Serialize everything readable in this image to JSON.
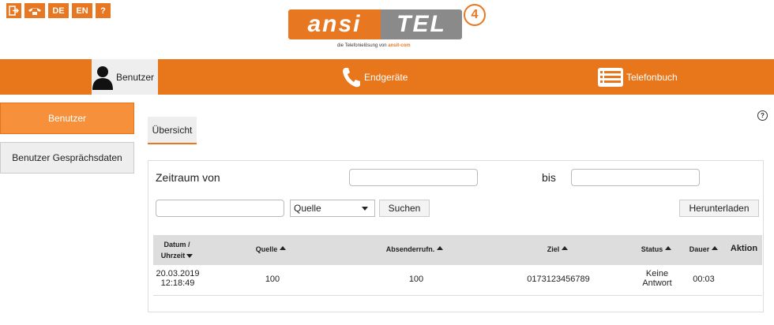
{
  "top_icons": {
    "logout": "logout-icon",
    "phone": "phone-icon",
    "lang_de": "DE",
    "lang_en": "EN",
    "help": "?"
  },
  "logo": {
    "left": "ansi",
    "right": "TEL",
    "number": "4",
    "tagline_prefix": "die Telefonielösung von",
    "tagline_brand": "ansit-com"
  },
  "nav": {
    "items": [
      {
        "label": "Benutzer",
        "icon": "user-icon"
      },
      {
        "label": "Endgeräte",
        "icon": "phone-icon"
      },
      {
        "label": "Telefonbuch",
        "icon": "list-icon"
      }
    ]
  },
  "sidebar": {
    "items": [
      {
        "label": "Benutzer"
      },
      {
        "label": "Benutzer Gesprächsdaten"
      }
    ]
  },
  "help_icon": "?",
  "tab": {
    "label": "Übersicht"
  },
  "filter": {
    "zeitraum_label": "Zeitraum von",
    "bis_label": "bis",
    "from_value": "",
    "to_value": "",
    "search_value": "",
    "select_value": "Quelle",
    "search_button": "Suchen",
    "download_button": "Herunterladen"
  },
  "table": {
    "headers": {
      "datum_line1": "Datum /",
      "datum_line2": "Uhrzeit",
      "quelle": "Quelle",
      "absender": "Absenderrufn.",
      "ziel": "Ziel",
      "status": "Status",
      "dauer": "Dauer",
      "aktion": "Aktion"
    },
    "rows": [
      {
        "date": "20.03.2019",
        "time": "12:18:49",
        "quelle": "100",
        "absender": "100",
        "ziel": "0173123456789",
        "status_line1": "Keine",
        "status_line2": "Antwort",
        "dauer": "00:03"
      }
    ]
  },
  "colors": {
    "accent": "#e8761b",
    "sidebar_active": "#f7903a",
    "header_bg": "#dddddd"
  }
}
